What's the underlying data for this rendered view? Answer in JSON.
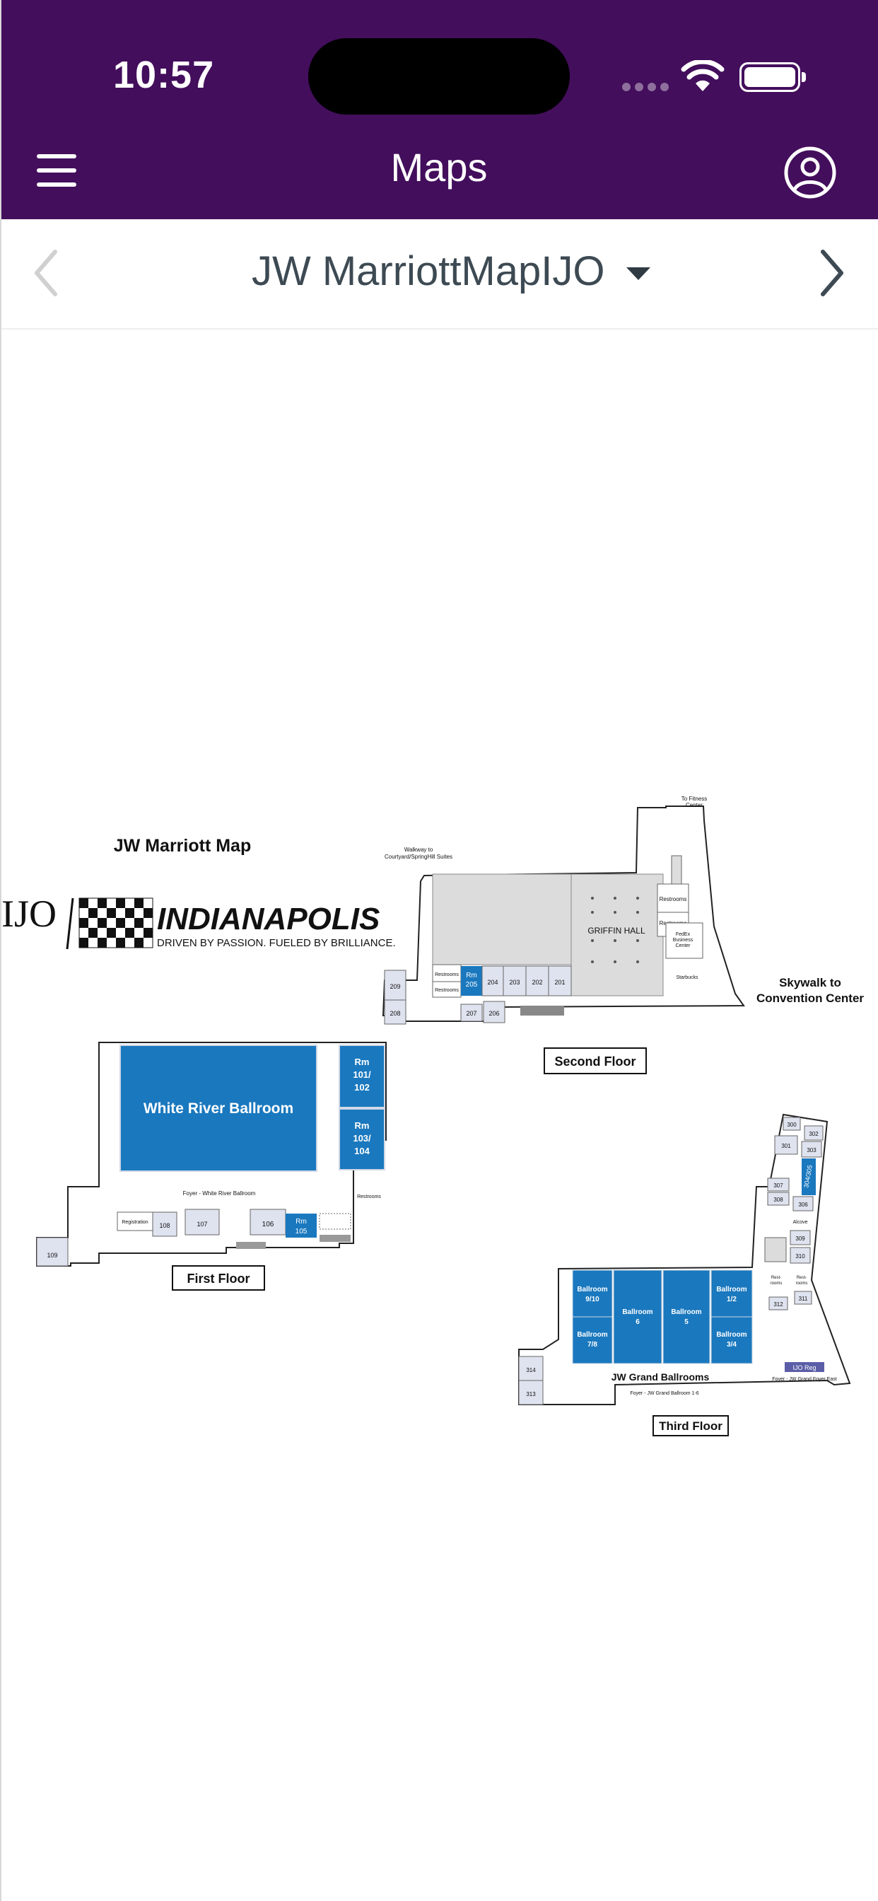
{
  "status_bar": {
    "time": "10:57"
  },
  "header": {
    "title": "Maps"
  },
  "selector": {
    "map_name": "JW MarriottMapIJO"
  },
  "map": {
    "heading": "JW Marriott Map",
    "logo_text": "IJO",
    "city": "INDIANAPOLIS",
    "tagline": "DRIVEN BY PASSION.  FUELED BY BRILLIANCE.",
    "first_floor": {
      "caption": "First Floor",
      "ballroom": "White River Ballroom",
      "foyer": "Foyer - White River Ballroom",
      "registration": "Registration",
      "restrooms": "Restrooms",
      "rm_101_102_a": "Rm",
      "rm_101_102_b": "101/",
      "rm_101_102_c": "102",
      "rm_103_104_a": "Rm",
      "rm_103_104_b": "103/",
      "rm_103_104_c": "104",
      "rm_105_a": "Rm",
      "rm_105_b": "105",
      "r106": "106",
      "r107": "107",
      "r108": "108",
      "r109": "109"
    },
    "second_floor": {
      "caption": "Second Floor",
      "griffin": "GRIFFIN HALL",
      "walkway_a": "Walkway to",
      "walkway_b": "Courtyard/SpringHill Suites",
      "fitness_a": "To Fitness",
      "fitness_b": "Center",
      "skywalk_a": "Skywalk to",
      "skywalk_b": "Convention Center",
      "restrooms": "Restrooms",
      "fedex_a": "FedEx",
      "fedex_b": "Business",
      "fedex_c": "Center",
      "starbucks": "Starbucks",
      "rm205_a": "Rm",
      "rm205_b": "205",
      "r201": "201",
      "r202": "202",
      "r203": "203",
      "r204": "204",
      "r206": "206",
      "r207": "207",
      "r208": "208",
      "r209": "209"
    },
    "third_floor": {
      "caption": "Third Floor",
      "grand": "JW Grand Ballrooms",
      "foyer": "Foyer - JW Grand Ballroom 1-6",
      "foyer_east": "Foyer - JW Grand Foyer East",
      "ijo_reg": "IJO Reg",
      "alcove": "Alcove",
      "b910_a": "Ballroom",
      "b910_b": "9/10",
      "b78_a": "Ballroom",
      "b78_b": "7/8",
      "b6_a": "Ballroom",
      "b6_b": "6",
      "b5_a": "Ballroom",
      "b5_b": "5",
      "b12_a": "Ballroom",
      "b12_b": "1/2",
      "b34_a": "Ballroom",
      "b34_b": "3/4",
      "r300": "300",
      "r301": "301",
      "r302": "302",
      "r303": "303",
      "r304": "304/305",
      "r306": "306",
      "r307": "307",
      "r308": "308",
      "r309": "309",
      "r310": "310",
      "r311": "311",
      "r312": "312",
      "r313": "313",
      "r314": "314",
      "restrooms_a": "Rest-",
      "restrooms_b": "rooms"
    }
  },
  "colors": {
    "header_bg": "#430e5c",
    "room_blue": "#1a78be",
    "room_light": "#dfe3ef",
    "hall_gray": "#dcdcdc"
  }
}
